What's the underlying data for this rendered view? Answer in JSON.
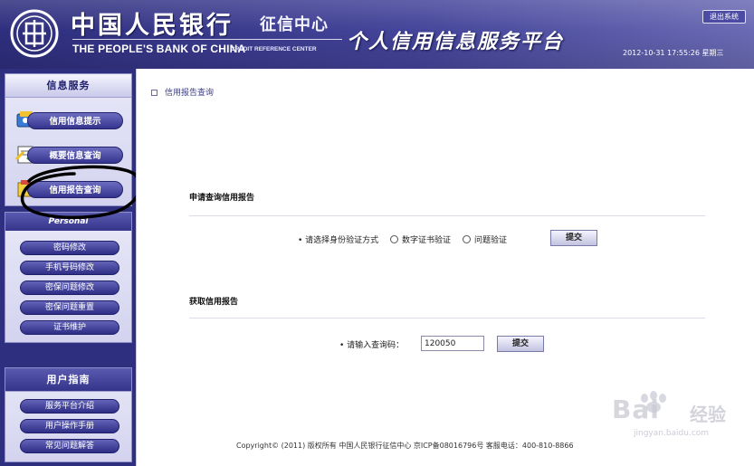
{
  "header": {
    "bank_name_cn": "中国人民银行",
    "center_name_cn": "征信中心",
    "bank_name_en": "THE PEOPLE'S BANK OF CHINA",
    "center_name_en": "CREDIT REFERENCE CENTER",
    "platform_title": "个人信用信息服务平台",
    "logout_label": "退出系统",
    "datetime": "2012-10-31 17:55:26 星期三",
    "emblem_icon": "bank-seal-icon"
  },
  "sidebar": {
    "info_service": {
      "title": "信息服务",
      "items": [
        {
          "label": "信用信息提示",
          "icon": "info-tip-icon"
        },
        {
          "label": "概要信息查询",
          "icon": "summary-query-icon"
        },
        {
          "label": "信用报告查询",
          "icon": "report-query-icon"
        }
      ]
    },
    "personal_settings": {
      "title": "Personal",
      "items": [
        {
          "label": "密码修改"
        },
        {
          "label": "手机号码修改"
        },
        {
          "label": "密保问题修改"
        },
        {
          "label": "密保问题重置"
        },
        {
          "label": "证书维护"
        }
      ]
    },
    "user_guide": {
      "title": "用户指南",
      "items": [
        {
          "label": "服务平台介绍"
        },
        {
          "label": "用户操作手册"
        },
        {
          "label": "常见问题解答"
        }
      ]
    }
  },
  "main": {
    "breadcrumb": "信用报告查询",
    "apply_section": {
      "title": "申请查询信用报告",
      "prompt": "• 请选择身份验证方式",
      "options": [
        "数字证书验证",
        "问题验证"
      ],
      "submit_label": "提交"
    },
    "fetch_section": {
      "title": "获取信用报告",
      "prompt": "• 请输入查询码：",
      "code_value": "120050",
      "submit_label": "提交"
    },
    "footer": "Copyright© (2011) 版权所有 中国人民银行征信中心 京ICP备08016796号 客服电话：400-810-8866"
  },
  "watermark": {
    "text": "Bai",
    "text_cn": "经验",
    "url": "jingyan.baidu.com"
  },
  "colors": {
    "header_bg": "#2e2e7e",
    "sidebar_bg": "#2f2f7f",
    "button_bg": "#34348e",
    "annotation_stroke": "#000000"
  }
}
